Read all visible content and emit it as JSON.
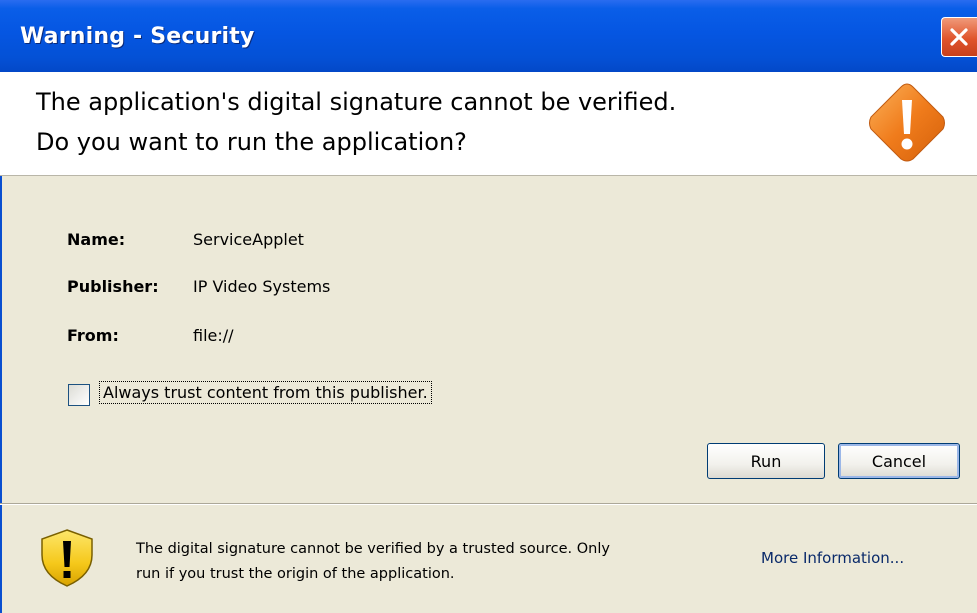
{
  "window": {
    "title": "Warning - Security"
  },
  "header": {
    "line1": "The application's digital signature cannot be verified.",
    "line2": "Do you want to run the application?"
  },
  "details": {
    "name_label": "Name:",
    "name_value": "ServiceApplet",
    "publisher_label": "Publisher:",
    "publisher_value": "IP Video Systems",
    "from_label": "From:",
    "from_value": "file://"
  },
  "trust": {
    "label": "Always trust content from this publisher.",
    "checked": false
  },
  "buttons": {
    "run": "Run",
    "cancel": "Cancel"
  },
  "footer": {
    "line1": "The digital signature cannot be verified by a trusted source.  Only",
    "line2": "run if you trust the origin of the application.",
    "more_info": "More Information..."
  },
  "colors": {
    "titlebar": "#0556e2",
    "close_button": "#e0542c",
    "warning_icon": "#f07c1c",
    "shield_icon": "#f5c81a",
    "dialog_bg": "#ece9d8"
  },
  "icons": {
    "warning": "warning-diamond-icon",
    "shield": "shield-exclamation-icon",
    "close": "close-icon"
  }
}
